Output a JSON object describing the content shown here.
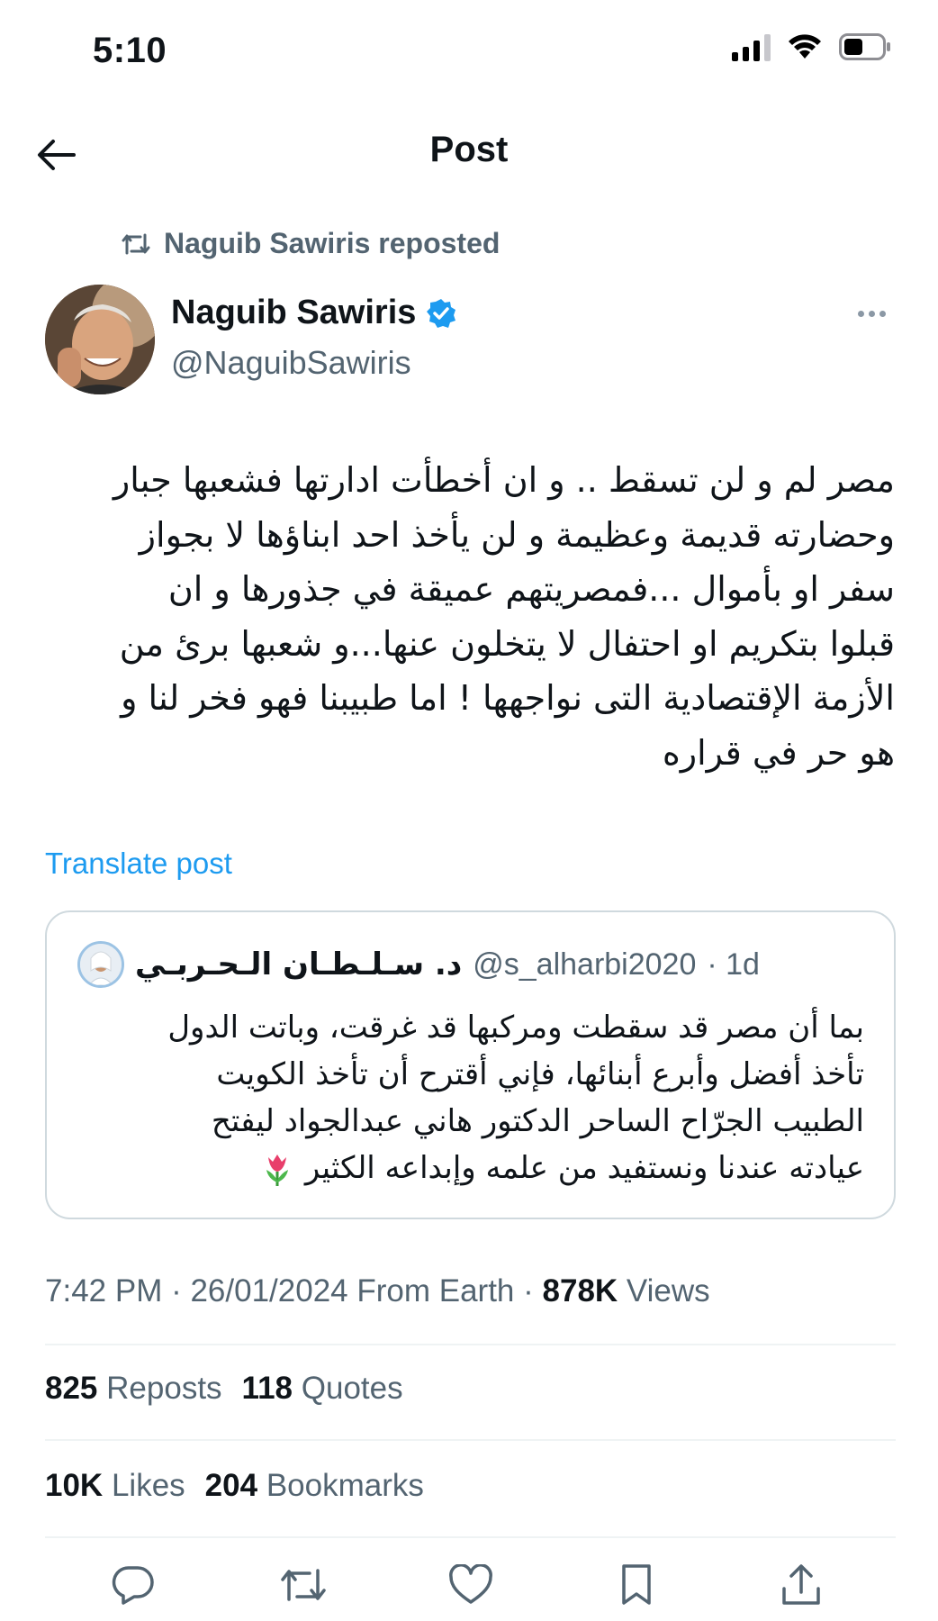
{
  "status_bar": {
    "time": "5:10"
  },
  "header": {
    "title": "Post"
  },
  "repost": {
    "text": "Naguib Sawiris reposted"
  },
  "author": {
    "name": "Naguib Sawiris",
    "handle": "@NaguibSawiris",
    "verified": true
  },
  "tweet": {
    "lines": [
      "مصر لم و لن تسقط .. و ان أخطأت ادارتها فشعبها جبار",
      "وحضارته قديمة وعظيمة و لن يأخذ احد ابناؤها لا بجواز",
      "سفر او بأموال ...فمصريتهم عميقة في جذورها و ان",
      "قبلوا بتكريم او احتفال لا يتخلون عنها...و شعبها برئ من",
      "الأزمة الإقتصادية التى نواجهها ! اما طبيبنا فهو فخر لنا و",
      "هو حر في قراره"
    ],
    "translate_label": "Translate post"
  },
  "quote": {
    "name": "د. سـلـطـان الـحـربـي",
    "handle": "@s_alharbi2020",
    "time": "· 1d",
    "lines": [
      "بما أن مصر قد سقطت ومركبها قد غرقت، وباتت الدول",
      "تأخذ أفضل وأبرع أبنائها، فإني أقترح أن تأخذ الكويت",
      "الطبيب الجرّاح الساحر الدكتور هاني عبدالجواد ليفتح",
      "عيادته عندنا ونستفيد من علمه وإبداعه الكثير"
    ]
  },
  "meta": {
    "time": "7:42 PM",
    "sep1": " · ",
    "date": "26/01/2024",
    "location": " From Earth",
    "sep2": " · ",
    "views_count": "878K",
    "views_label": " Views"
  },
  "stats": {
    "reposts_count": "825",
    "reposts_label": "Reposts",
    "quotes_count": "118",
    "quotes_label": "Quotes",
    "likes_count": "10K",
    "likes_label": "Likes",
    "bookmarks_count": "204",
    "bookmarks_label": "Bookmarks"
  },
  "colors": {
    "link": "#1d9bf0",
    "muted": "#536471",
    "verified": "#1d9bf0",
    "divider": "#eff3f4"
  },
  "icons": [
    "back-arrow-icon",
    "repost-icon",
    "verified-badge-icon",
    "more-icon",
    "tulip-icon",
    "reply-icon",
    "retweet-icon",
    "like-icon",
    "bookmark-icon",
    "share-icon"
  ]
}
